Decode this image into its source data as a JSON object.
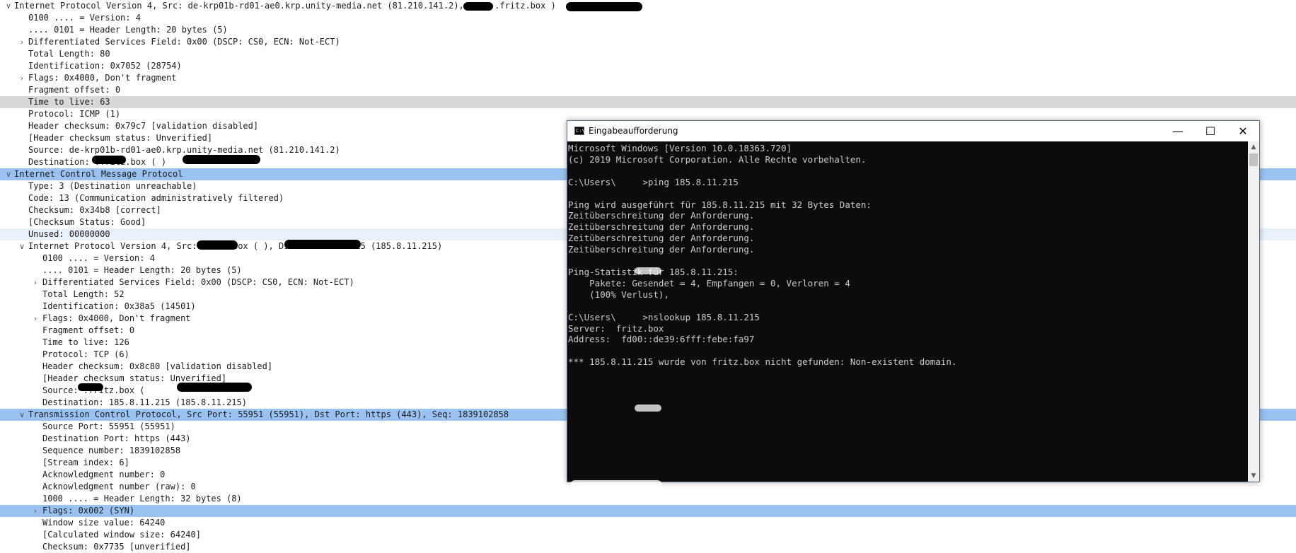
{
  "packet_tree": {
    "rows": [
      {
        "indent": 0,
        "caret": "down",
        "text": "Internet Protocol Version 4, Src: de-krp01b-rd01-ae0.krp.unity-media.net (81.210.141.2), Dst:          .fritz.box                )",
        "style": "normal"
      },
      {
        "indent": 1,
        "caret": "",
        "text": "0100 .... = Version: 4",
        "style": "normal"
      },
      {
        "indent": 1,
        "caret": "",
        "text": ".... 0101 = Header Length: 20 bytes (5)",
        "style": "normal"
      },
      {
        "indent": 1,
        "caret": "right",
        "text": "Differentiated Services Field: 0x00 (DSCP: CS0, ECN: Not-ECT)",
        "style": "normal"
      },
      {
        "indent": 1,
        "caret": "",
        "text": "Total Length: 80",
        "style": "normal"
      },
      {
        "indent": 1,
        "caret": "",
        "text": "Identification: 0x7052 (28754)",
        "style": "normal"
      },
      {
        "indent": 1,
        "caret": "right",
        "text": "Flags: 0x4000, Don't fragment",
        "style": "normal"
      },
      {
        "indent": 1,
        "caret": "",
        "text": "Fragment offset: 0",
        "style": "normal"
      },
      {
        "indent": 1,
        "caret": "",
        "text": "Time to live: 63",
        "style": "highlight"
      },
      {
        "indent": 1,
        "caret": "",
        "text": "Protocol: ICMP (1)",
        "style": "normal"
      },
      {
        "indent": 1,
        "caret": "",
        "text": "Header checksum: 0x79c7 [validation disabled]",
        "style": "normal"
      },
      {
        "indent": 1,
        "caret": "",
        "text": "[Header checksum status: Unverified]",
        "style": "normal"
      },
      {
        "indent": 1,
        "caret": "",
        "text": "Source: de-krp01b-rd01-ae0.krp.unity-media.net (81.210.141.2)",
        "style": "normal"
      },
      {
        "indent": 1,
        "caret": "",
        "text": "Destination:         .fritz.box (              )",
        "style": "normal"
      },
      {
        "indent": 0,
        "caret": "down",
        "text": "Internet Control Message Protocol",
        "style": "selected"
      },
      {
        "indent": 1,
        "caret": "",
        "text": "Type: 3 (Destination unreachable)",
        "style": "normal"
      },
      {
        "indent": 1,
        "caret": "",
        "text": "Code: 13 (Communication administratively filtered)",
        "style": "normal"
      },
      {
        "indent": 1,
        "caret": "",
        "text": "Checksum: 0x34b8 [correct]",
        "style": "normal"
      },
      {
        "indent": 1,
        "caret": "",
        "text": "[Checksum Status: Good]",
        "style": "normal"
      },
      {
        "indent": 1,
        "caret": "",
        "text": "Unused: 00000000",
        "style": "unused"
      },
      {
        "indent": 1,
        "caret": "down",
        "text": "Internet Protocol Version 4, Src:         fritz.box (              ), Dst: 185.8.11.215 (185.8.11.215)",
        "style": "normal"
      },
      {
        "indent": 2,
        "caret": "",
        "text": "0100 .... = Version: 4",
        "style": "normal"
      },
      {
        "indent": 2,
        "caret": "",
        "text": ".... 0101 = Header Length: 20 bytes (5)",
        "style": "normal"
      },
      {
        "indent": 2,
        "caret": "right",
        "text": "Differentiated Services Field: 0x00 (DSCP: CS0, ECN: Not-ECT)",
        "style": "normal"
      },
      {
        "indent": 2,
        "caret": "",
        "text": "Total Length: 52",
        "style": "normal"
      },
      {
        "indent": 2,
        "caret": "",
        "text": "Identification: 0x38a5 (14501)",
        "style": "normal"
      },
      {
        "indent": 2,
        "caret": "right",
        "text": "Flags: 0x4000, Don't fragment",
        "style": "normal"
      },
      {
        "indent": 2,
        "caret": "",
        "text": "Fragment offset: 0",
        "style": "normal"
      },
      {
        "indent": 2,
        "caret": "",
        "text": "Time to live: 126",
        "style": "normal"
      },
      {
        "indent": 2,
        "caret": "",
        "text": "Protocol: TCP (6)",
        "style": "normal"
      },
      {
        "indent": 2,
        "caret": "",
        "text": "Header checksum: 0x8c80 [validation disabled]",
        "style": "normal"
      },
      {
        "indent": 2,
        "caret": "",
        "text": "[Header checksum status: Unverified]",
        "style": "normal"
      },
      {
        "indent": 2,
        "caret": "",
        "text": "Source:        .fritz.box (            ",
        "style": "normal"
      },
      {
        "indent": 2,
        "caret": "",
        "text": "Destination: 185.8.11.215 (185.8.11.215)",
        "style": "normal"
      },
      {
        "indent": 1,
        "caret": "down",
        "text": "Transmission Control Protocol, Src Port: 55951 (55951), Dst Port: https (443), Seq: 1839102858",
        "style": "selected"
      },
      {
        "indent": 2,
        "caret": "",
        "text": "Source Port: 55951 (55951)",
        "style": "normal"
      },
      {
        "indent": 2,
        "caret": "",
        "text": "Destination Port: https (443)",
        "style": "normal"
      },
      {
        "indent": 2,
        "caret": "",
        "text": "Sequence number: 1839102858",
        "style": "normal"
      },
      {
        "indent": 2,
        "caret": "",
        "text": "[Stream index: 6]",
        "style": "normal"
      },
      {
        "indent": 2,
        "caret": "",
        "text": "Acknowledgment number: 0",
        "style": "normal"
      },
      {
        "indent": 2,
        "caret": "",
        "text": "Acknowledgment number (raw): 0",
        "style": "normal"
      },
      {
        "indent": 2,
        "caret": "",
        "text": "1000 .... = Header Length: 32 bytes (8)",
        "style": "normal"
      },
      {
        "indent": 2,
        "caret": "right",
        "text": "Flags: 0x002 (SYN)",
        "style": "selected"
      },
      {
        "indent": 2,
        "caret": "",
        "text": "Window size value: 64240",
        "style": "normal"
      },
      {
        "indent": 2,
        "caret": "",
        "text": "[Calculated window size: 64240]",
        "style": "normal"
      },
      {
        "indent": 2,
        "caret": "",
        "text": "Checksum: 0x7735 [unverified]",
        "style": "normal"
      }
    ]
  },
  "console": {
    "title": "Eingabeaufforderung",
    "icon_label": "C:\\.",
    "minimize_glyph": "—",
    "maximize_glyph": "☐",
    "close_glyph": "✕",
    "scroll_up_glyph": "▲",
    "scroll_down_glyph": "▼",
    "lines": [
      "Microsoft Windows [Version 10.0.18363.720]",
      "(c) 2019 Microsoft Corporation. Alle Rechte vorbehalten.",
      "",
      "C:\\Users\\     >ping 185.8.11.215",
      "",
      "Ping wird ausgeführt für 185.8.11.215 mit 32 Bytes Daten:",
      "Zeitüberschreitung der Anforderung.",
      "Zeitüberschreitung der Anforderung.",
      "Zeitüberschreitung der Anforderung.",
      "Zeitüberschreitung der Anforderung.",
      "",
      "Ping-Statistik für 185.8.11.215:",
      "    Pakete: Gesendet = 4, Empfangen = 0, Verloren = 4",
      "    (100% Verlust),",
      "",
      "C:\\Users\\     >nslookup 185.8.11.215",
      "Server:  fritz.box",
      "Address:  fd00::de39:6fff:febe:fa97",
      "",
      "*** 185.8.11.215 wurde von fritz.box nicht gefunden: Non-existent domain.",
      "",
      ""
    ]
  }
}
